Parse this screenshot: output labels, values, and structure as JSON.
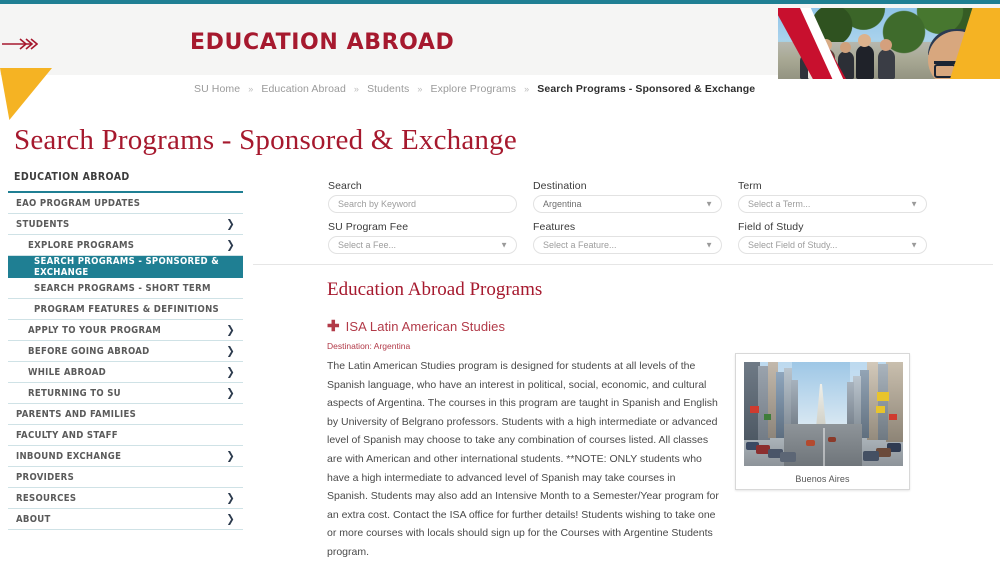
{
  "colors": {
    "teal": "#1f7f93",
    "crimson": "#a6192e",
    "program_red": "#b23a48",
    "yellow": "#f5b323",
    "banner_red": "#c8102e"
  },
  "header": {
    "title": "EDUCATION ABROAD",
    "arrow_icon": "triple-chevron-arrow-icon",
    "banner_photo_alt": "students-group-photo"
  },
  "breadcrumb": {
    "items": [
      {
        "label": "SU Home",
        "current": false
      },
      {
        "label": "Education Abroad",
        "current": false
      },
      {
        "label": "Students",
        "current": false
      },
      {
        "label": "Explore Programs",
        "current": false
      },
      {
        "label": "Search Programs - Sponsored & Exchange",
        "current": true
      }
    ],
    "separator": "»"
  },
  "page": {
    "title": "Search Programs - Sponsored & Exchange"
  },
  "sidebar": {
    "heading": "EDUCATION ABROAD",
    "items": [
      {
        "label": "EAO PROGRAM UPDATES",
        "level": 1,
        "chevron": false,
        "active": false
      },
      {
        "label": "STUDENTS",
        "level": 1,
        "chevron": true,
        "active": false
      },
      {
        "label": "EXPLORE PROGRAMS",
        "level": 2,
        "chevron": true,
        "active": false
      },
      {
        "label": "SEARCH PROGRAMS - SPONSORED & EXCHANGE",
        "level": 3,
        "chevron": false,
        "active": true
      },
      {
        "label": "SEARCH PROGRAMS - SHORT TERM",
        "level": 3,
        "chevron": false,
        "active": false
      },
      {
        "label": "PROGRAM FEATURES & DEFINITIONS",
        "level": 3,
        "chevron": false,
        "active": false
      },
      {
        "label": "APPLY TO YOUR PROGRAM",
        "level": 2,
        "chevron": true,
        "active": false
      },
      {
        "label": "BEFORE GOING ABROAD",
        "level": 2,
        "chevron": true,
        "active": false
      },
      {
        "label": "WHILE ABROAD",
        "level": 2,
        "chevron": true,
        "active": false
      },
      {
        "label": "RETURNING TO SU",
        "level": 2,
        "chevron": true,
        "active": false
      },
      {
        "label": "PARENTS AND FAMILIES",
        "level": 1,
        "chevron": false,
        "active": false
      },
      {
        "label": "FACULTY AND STAFF",
        "level": 1,
        "chevron": false,
        "active": false
      },
      {
        "label": "INBOUND EXCHANGE",
        "level": 1,
        "chevron": true,
        "active": false
      },
      {
        "label": "PROVIDERS",
        "level": 1,
        "chevron": false,
        "active": false
      },
      {
        "label": "RESOURCES",
        "level": 1,
        "chevron": true,
        "active": false
      },
      {
        "label": "ABOUT",
        "level": 1,
        "chevron": true,
        "active": false
      }
    ],
    "chevron_icon": "chevron-right-icon"
  },
  "filters": {
    "search": {
      "label": "Search",
      "placeholder": "Search by Keyword",
      "value": ""
    },
    "destination": {
      "label": "Destination",
      "value": "Argentina"
    },
    "term": {
      "label": "Term",
      "value": "Select a Term..."
    },
    "su_program_fee": {
      "label": "SU Program Fee",
      "value": "Select a Fee..."
    },
    "features": {
      "label": "Features",
      "value": "Select a Feature..."
    },
    "field_of_study": {
      "label": "Field of Study",
      "value": "Select Field of Study..."
    },
    "caret_icon": "chevron-down-icon"
  },
  "main": {
    "heading": "Education Abroad Programs",
    "program": {
      "expand_icon": "plus-icon",
      "title": "ISA Latin American Studies",
      "destination": "Destination: Argentina",
      "description": "The Latin American Studies program is designed for students at all levels of the Spanish language, who have an interest in political, social, economic, and cultural aspects of Argentina. The courses in this program are taught in Spanish and English by University of Belgrano professors. Students with a high intermediate or advanced level of Spanish may choose to take any combination of courses listed. All classes are with American and other international students. **NOTE: ONLY students who have a high intermediate to advanced level of Spanish may take courses in Spanish. Students may also add an Intensive Month to a Semester/Year program for an extra cost. Contact the ISA office for further details! Students wishing to take one or more courses with locals should sign up for the Courses with Argentine Students program.",
      "image_caption": "Buenos Aires",
      "image_alt": "buenos-aires-street-photo"
    }
  }
}
